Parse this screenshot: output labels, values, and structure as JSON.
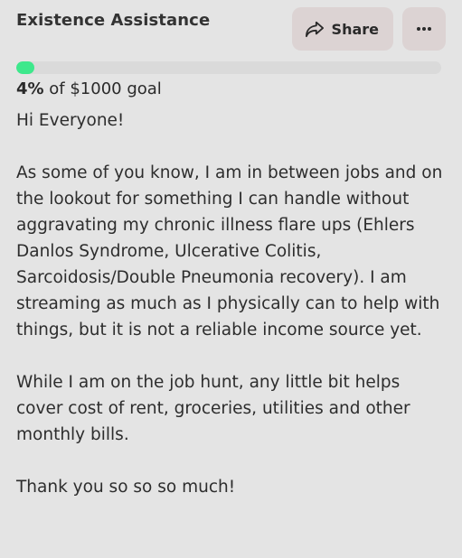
{
  "header": {
    "title": "Existence Assistance",
    "share_label": "Share"
  },
  "progress": {
    "percent_label": "4%",
    "goal_text": " of $1000 goal",
    "fraction": 0.04
  },
  "description": {
    "paragraphs": [
      "Hi Everyone!",
      "As some of you know, I am in between jobs and on the lookout for something I can handle without aggravating my chronic illness flare ups (Ehlers Danlos Syndrome, Ulcerative Colitis, Sarcoidosis/Double Pneumonia recovery). I am streaming as much as I physically can to help with things, but it is not a reliable income source yet.",
      "While I am on the job hunt, any little bit helps cover cost of rent, groceries, utilities and other monthly bills.",
      "Thank you so so so much!"
    ]
  },
  "colors": {
    "progress_fill": "#3ee88c",
    "button_bg": "#dcd3d3",
    "card_bg": "#e4e4e4"
  },
  "icons": {
    "share": "share-icon",
    "more": "more-horizontal-icon"
  }
}
